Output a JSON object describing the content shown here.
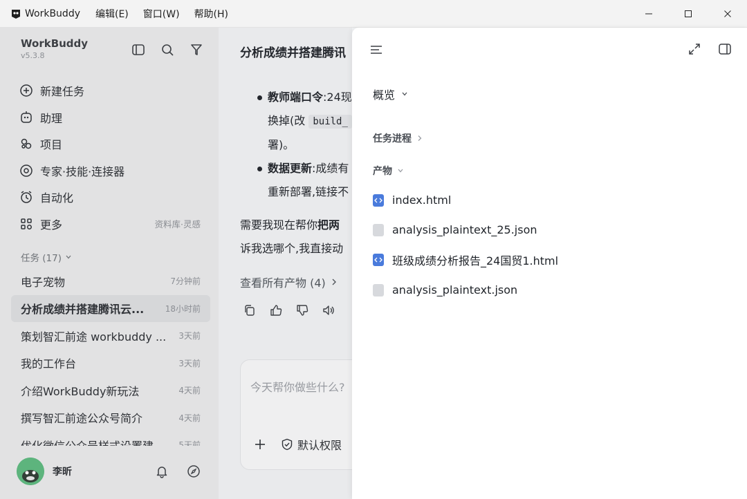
{
  "titlebar": {
    "app_name": "WorkBuddy",
    "menu": [
      "编辑(E)",
      "窗口(W)",
      "帮助(H)"
    ]
  },
  "sidebar": {
    "app_name": "WorkBuddy",
    "version": "v5.3.8",
    "nav": [
      {
        "label": "新建任务",
        "icon": "plus-circle-icon"
      },
      {
        "label": "助理",
        "icon": "assistant-icon"
      },
      {
        "label": "项目",
        "icon": "project-icon"
      },
      {
        "label": "专家·技能·连接器",
        "icon": "expert-icon"
      },
      {
        "label": "自动化",
        "icon": "alarm-icon"
      },
      {
        "label": "更多",
        "icon": "grid-icon",
        "extra": "资料库·灵感"
      }
    ],
    "tasks_header": "任务 (17)",
    "tasks": [
      {
        "label": "电子宠物",
        "time": "7分钟前"
      },
      {
        "label": "分析成绩并搭建腾讯云...",
        "time": "18小时前",
        "active": true
      },
      {
        "label": "策划智汇前途 workbuddy ...",
        "time": "3天前"
      },
      {
        "label": "我的工作台",
        "time": "3天前"
      },
      {
        "label": "介绍WorkBuddy新玩法",
        "time": "4天前"
      },
      {
        "label": "撰写智汇前途公众号简介",
        "time": "4天前"
      },
      {
        "label": "优化微信公众号样式设置建",
        "time": "5天前"
      }
    ],
    "user_name": "李昕"
  },
  "chat": {
    "title": "分析成绩并搭建腾讯",
    "bullet1_bold": "教师端口令",
    "bullet1_text": ":24现",
    "bullet1_line2a": "换掉(改 ",
    "bullet1_code": "build_",
    "bullet1_line3": "署)。",
    "bullet2_bold": "数据更新",
    "bullet2_text": ":成绩有",
    "bullet2_line2": "重新部署,链接不",
    "para_a": "需要我现在帮你",
    "para_bold": "把两",
    "para_line2": "诉我选哪个,我直接动",
    "view_all": "查看所有产物 (4)",
    "input_placeholder": "今天帮你做些什么?",
    "permission": "默认权限"
  },
  "panel": {
    "overview": "概览",
    "progress": "任务进程",
    "artifacts": "产物",
    "files": [
      {
        "name": "index.html",
        "type": "html"
      },
      {
        "name": "analysis_plaintext_25.json",
        "type": "json"
      },
      {
        "name": "班级成绩分析报告_24国贸1.html",
        "type": "html"
      },
      {
        "name": "analysis_plaintext.json",
        "type": "json"
      }
    ]
  }
}
